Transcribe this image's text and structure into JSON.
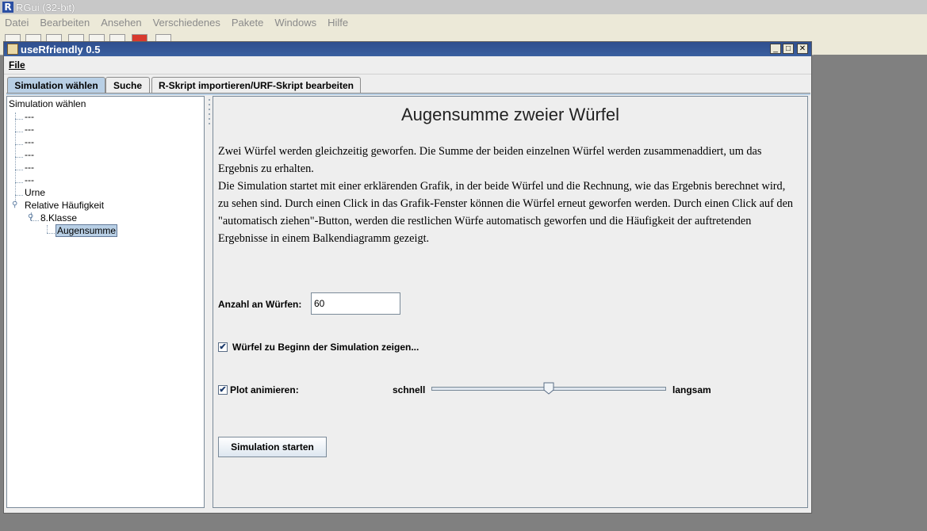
{
  "rgui": {
    "title": "RGui (32-bit)",
    "logo": "R",
    "menu": [
      "Datei",
      "Bearbeiten",
      "Ansehen",
      "Verschiedenes",
      "Pakete",
      "Windows",
      "Hilfe"
    ]
  },
  "window": {
    "title": "useRfriendly 0.5",
    "menu_file": "File"
  },
  "tabs": [
    "Simulation wählen",
    "Suche",
    "R-Skript importieren/URF-Skript bearbeiten"
  ],
  "tree": {
    "root": "Simulation wählen",
    "items": [
      "---",
      "---",
      "---",
      "---",
      "---",
      "---",
      "Urne",
      "Relative Häufigkeit",
      "8.Klasse",
      "Augensumme"
    ]
  },
  "content": {
    "heading": "Augensumme zweier Würfel",
    "description_1": "Zwei Würfel werden gleichzeitig geworfen. Die Summe der beiden einzelnen Würfel werden zusammenaddiert, um das Ergebnis zu erhalten.",
    "description_2": "Die Simulation startet mit einer erklärenden Grafik, in der beide Würfel und die Rechnung, wie das Ergebnis berechnet wird, zu sehen sind. Durch einen Click in das Grafik-Fenster können die Würfel erneut geworfen werden. Durch einen Click auf den \"automatisch ziehen\"-Button, werden die restlichen Würfe automatisch geworfen und die Häufigkeit der auftretenden Ergebnisse in einem Balkendiagramm gezeigt.",
    "anzahl_label": "Anzahl an Würfen:",
    "anzahl_value": "60",
    "checkbox_wuerfel_label": "Würfel zu Beginn der Simulation zeigen...",
    "checkbox_wuerfel_checked": true,
    "checkbox_plot_label": "Plot animieren:",
    "checkbox_plot_checked": true,
    "slider_left_label": "schnell",
    "slider_right_label": "langsam",
    "slider_value": 0.5,
    "start_button": "Simulation starten"
  }
}
